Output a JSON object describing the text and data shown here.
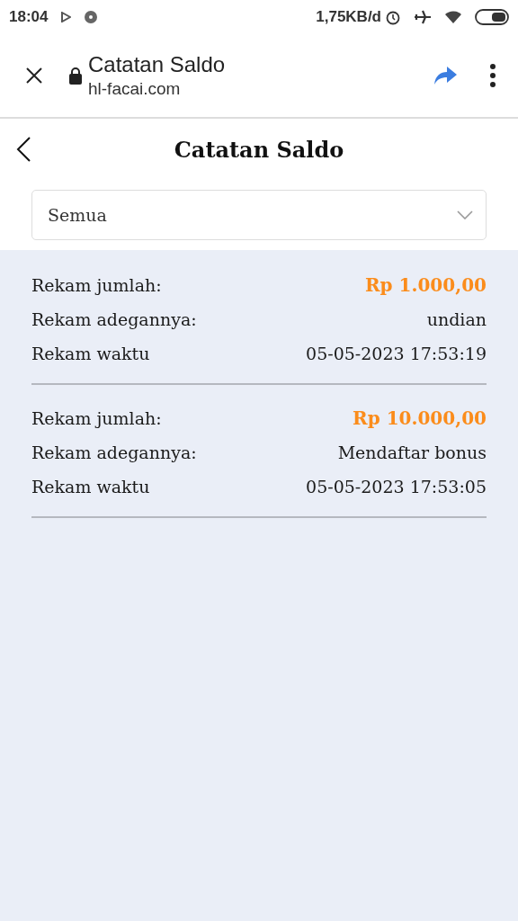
{
  "status_bar": {
    "time": "18:04",
    "network_speed": "1,75KB/d"
  },
  "browser_bar": {
    "title": "Catatan Saldo",
    "url": "hl-facai.com"
  },
  "header": {
    "title": "Catatan Saldo"
  },
  "filter": {
    "value": "Semua"
  },
  "records": [
    {
      "rows": [
        {
          "kind": "amount",
          "label": "Rekam jumlah:",
          "value": "Rp 1.000,00"
        },
        {
          "kind": "plain",
          "label": "Rekam adegannya:",
          "value": "undian"
        },
        {
          "kind": "plain",
          "label": "Rekam waktu",
          "value": "05-05-2023 17:53:19"
        }
      ]
    },
    {
      "rows": [
        {
          "kind": "amount",
          "label": "Rekam jumlah:",
          "value": "Rp 10.000,00"
        },
        {
          "kind": "plain",
          "label": "Rekam adegannya:",
          "value": "Mendaftar bonus"
        },
        {
          "kind": "plain",
          "label": "Rekam waktu",
          "value": "05-05-2023 17:53:05"
        }
      ]
    }
  ]
}
